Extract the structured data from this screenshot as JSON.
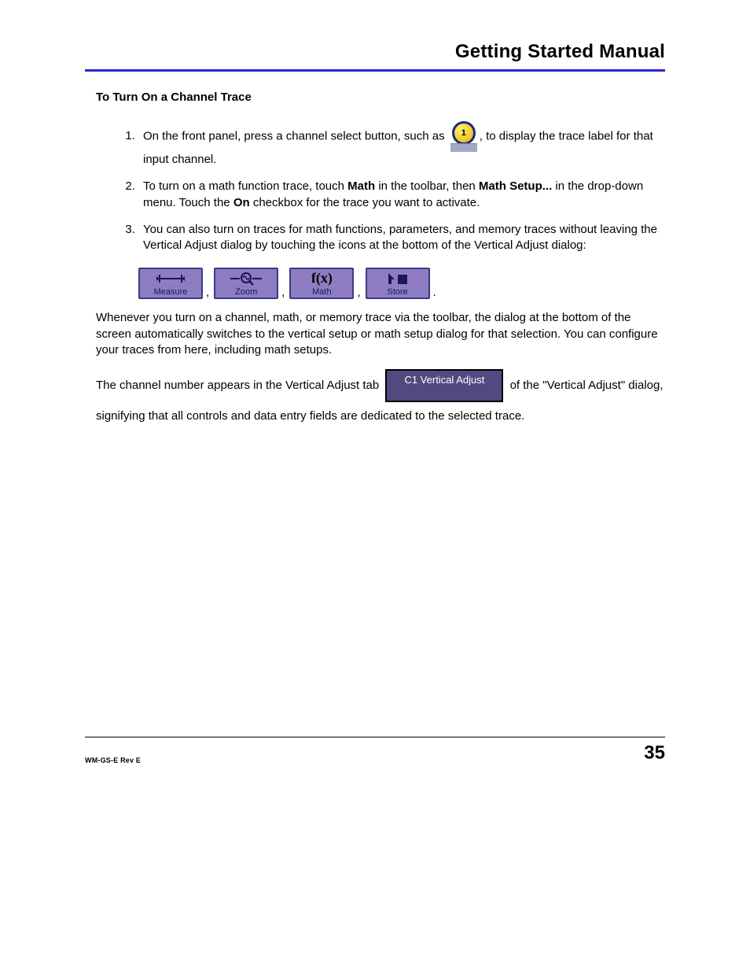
{
  "header": {
    "title": "Getting Started Manual"
  },
  "section": {
    "title": "To Turn On a Channel Trace"
  },
  "steps": {
    "s1a": "On the front panel, press a channel select button, such as ",
    "s1b": ", to display the trace label for that input channel.",
    "s2a": "To turn on a math function trace, touch ",
    "s2_math": "Math",
    "s2b": " in the toolbar, then ",
    "s2_mathsetup": "Math Setup...",
    "s2c": " in the drop-down menu. Touch the ",
    "s2_on": "On",
    "s2d": " checkbox for the trace you want to activate.",
    "s3": "You can also turn on traces for math functions, parameters, and memory traces without leaving the Vertical Adjust dialog by touching the icons at the bottom of the Vertical Adjust dialog:"
  },
  "buttons": {
    "channel_digit": "1",
    "measure": "Measure",
    "zoom": "Zoom",
    "math": "Math",
    "math_fx": "f(x)",
    "store": "Store"
  },
  "para1": "Whenever you turn on a channel, math, or memory trace via the toolbar, the dialog at the bottom of the screen automatically switches to the vertical setup or math setup dialog for that selection. You can configure your traces from here, including math setups.",
  "para2a": "The channel number appears in the Vertical Adjust tab ",
  "tab_label": "C1 Vertical Adjust",
  "para2b": " of the \"Vertical Adjust\" dialog, signifying that all controls and data entry fields are dedicated to the selected trace.",
  "footer": {
    "rev": "WM-GS-E Rev E",
    "page": "35"
  },
  "punct": {
    "comma": ",",
    "period": "."
  }
}
